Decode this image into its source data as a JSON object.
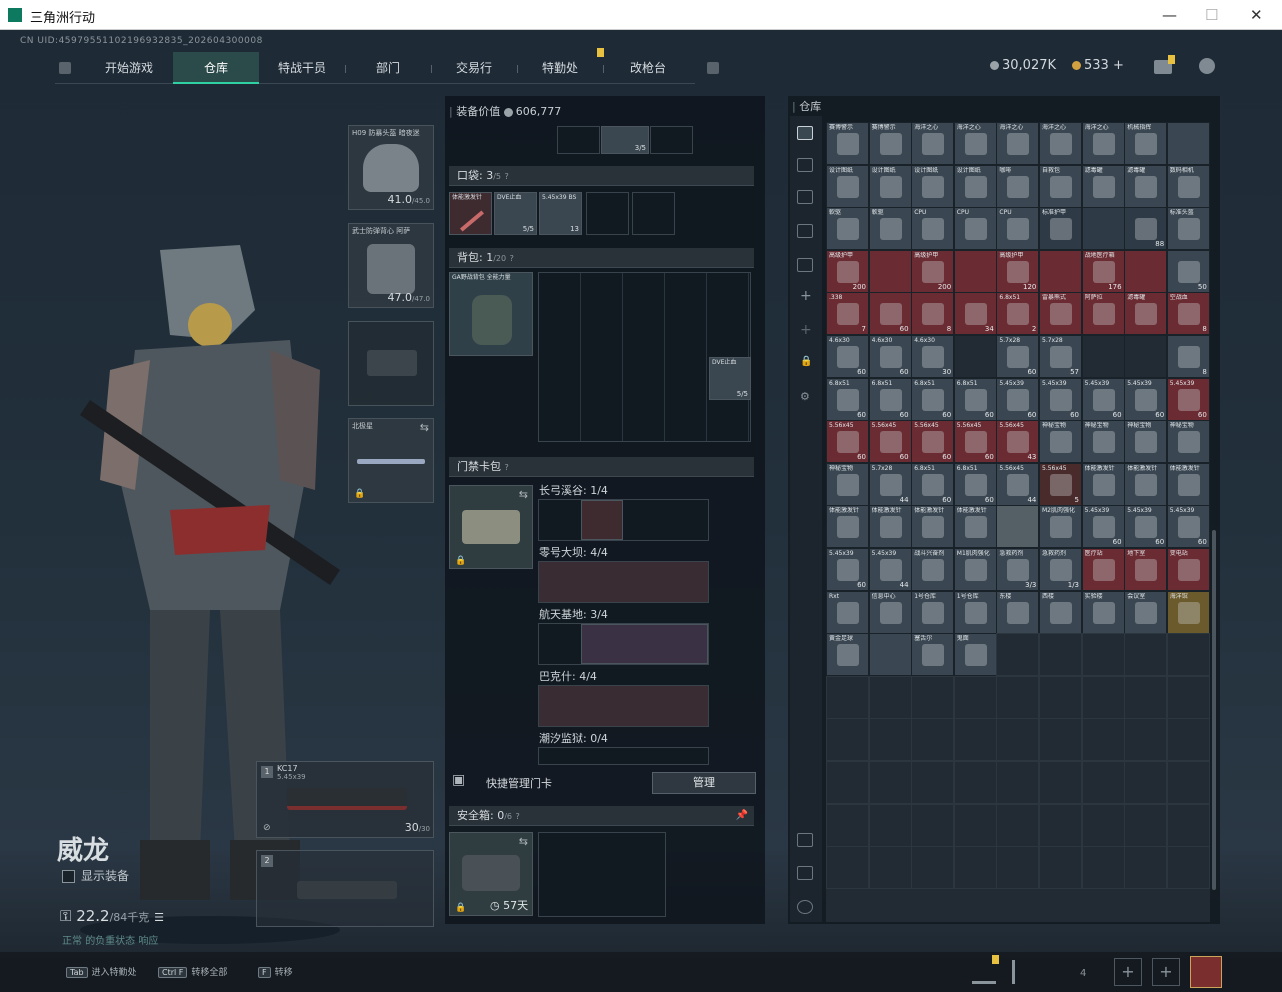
{
  "window": {
    "title": "三角洲行动",
    "minimize": "—",
    "maximize": "☐",
    "close": "✕"
  },
  "uid": "CN UID:4597955110219693283​5_2026043000​08",
  "nav": {
    "tabs": [
      "开始游戏",
      "仓库",
      "特战干员",
      "部门",
      "交易行",
      "特勤处",
      "改枪台"
    ],
    "active": "仓库"
  },
  "currency": {
    "hafcoin": "30,027K",
    "coupons": "533",
    "plus": "+"
  },
  "operator": {
    "name": "威龙",
    "show_equipment": "显示装备",
    "weight": "22.2",
    "weight_max": "/84千克",
    "status_a": "正常",
    "status_b": "的负重状态",
    "status_c": "响应"
  },
  "equip_slots": {
    "helmet": {
      "label": "H09 防暴头盔 暗夜迷",
      "value": "41.0",
      "max": "/45.0"
    },
    "armor": {
      "label": "武士防弹背心 阿萨",
      "value": "47.0",
      "max": "/47.0"
    },
    "melee": {
      "label": "北极星"
    }
  },
  "weapons": [
    {
      "index": "1",
      "name": "KC17",
      "caliber": "5.45x39",
      "ammo": "30",
      "ammo_max": "/30"
    },
    {
      "index": "2"
    }
  ],
  "mid": {
    "equip_value_label": "装备价值",
    "equip_value": "606,777",
    "rig_item_count": "3/5",
    "pocket": {
      "label": "口袋:",
      "count": "3",
      "max": "/5",
      "items": [
        {
          "name": "体能激发针",
          "count": ""
        },
        {
          "name": "DVE止血",
          "count": "5/5"
        },
        {
          "name": "5.45x39 BS",
          "count": "13"
        }
      ]
    },
    "backpack": {
      "label": "背包:",
      "count": "1",
      "max": "/20",
      "name": "GA野战背包 全能力量",
      "item": {
        "name": "DVE止血",
        "count": "5/5"
      }
    },
    "keycase": {
      "label": "门禁卡包",
      "maps": [
        {
          "name": "长弓溪谷: 1/4"
        },
        {
          "name": "零号大坝: 4/4"
        },
        {
          "name": "航天基地: 3/4"
        },
        {
          "name": "巴克什: 4/4"
        },
        {
          "name": "潮汐监狱: 0/4"
        }
      ]
    },
    "quick_keycard": "快捷管理门卡",
    "manage": "管理",
    "safebox": {
      "label": "安全箱:",
      "count": "0",
      "max": "/6",
      "timer": "57天"
    }
  },
  "stash": {
    "title": "仓库"
  },
  "stash_items": [
    {
      "n": "赛博警示",
      "c": "",
      "col": "#3a4651"
    },
    {
      "n": "赛博警示",
      "c": "",
      "col": "#3a4651"
    },
    {
      "n": "海洋之心",
      "c": "",
      "col": "#3a4651"
    },
    {
      "n": "海洋之心",
      "c": "",
      "col": "#3a4651"
    },
    {
      "n": "海洋之心",
      "c": "",
      "col": "#3a4651"
    },
    {
      "n": "海洋之心",
      "c": "",
      "col": "#3a4651"
    },
    {
      "n": "海洋之心",
      "c": "",
      "col": "#3a4651"
    },
    {
      "n": "机械指挥",
      "c": "",
      "col": "#3a4651"
    },
    {
      "n": "",
      "c": "",
      "col": "#3a4651"
    },
    {
      "n": "设计图纸",
      "c": "",
      "col": "#3a4651"
    },
    {
      "n": "设计图纸",
      "c": "",
      "col": "#3a4651"
    },
    {
      "n": "设计图纸",
      "c": "",
      "col": "#3a4651"
    },
    {
      "n": "设计图纸",
      "c": "",
      "col": "#3a4651"
    },
    {
      "n": "咖啡",
      "c": "",
      "col": "#3a4651"
    },
    {
      "n": "自救包",
      "c": "",
      "col": "#3a4651"
    },
    {
      "n": "滤毒罐",
      "c": "",
      "col": "#3a4651"
    },
    {
      "n": "滤毒罐",
      "c": "",
      "col": "#3a4651"
    },
    {
      "n": "数码相机",
      "c": "",
      "col": "#3a4651"
    },
    {
      "n": "軟驱",
      "c": "",
      "col": "#3a4651"
    },
    {
      "n": "軟驱",
      "c": "",
      "col": "#3a4651"
    },
    {
      "n": "CPU",
      "c": "",
      "col": "#3a4651"
    },
    {
      "n": "CPU",
      "c": "",
      "col": "#3a4651"
    },
    {
      "n": "CPU",
      "c": "",
      "col": "#3a4651"
    },
    {
      "n": "标准护甲",
      "c": "",
      "col": "#2e3a46"
    },
    {
      "n": "",
      "c": "",
      "col": "#2e3a46"
    },
    {
      "n": "",
      "c": "88",
      "col": "#2e3a46"
    },
    {
      "n": "标准头盔",
      "c": "",
      "col": "#3a4651"
    },
    {
      "n": "高级护甲",
      "c": "200",
      "col": "#6b2b33"
    },
    {
      "n": "",
      "c": "",
      "col": "#6b2b33"
    },
    {
      "n": "高级护甲",
      "c": "200",
      "col": "#6b2b33"
    },
    {
      "n": "",
      "c": "",
      "col": "#6b2b33"
    },
    {
      "n": "高级护甲",
      "c": "120",
      "col": "#6b2b33"
    },
    {
      "n": "",
      "c": "",
      "col": "#6b2b33"
    },
    {
      "n": "战地医疗箱",
      "c": "176",
      "col": "#6b2b33"
    },
    {
      "n": "",
      "c": "",
      "col": "#6b2b33"
    },
    {
      "n": "",
      "c": "50",
      "col": "#3a4651"
    },
    {
      "n": ".338",
      "c": "7",
      "col": "#6b2b33"
    },
    {
      "n": "",
      "c": "60",
      "col": "#6b2b33"
    },
    {
      "n": "",
      "c": "8",
      "col": "#6b2b33"
    },
    {
      "n": "",
      "c": "34",
      "col": "#6b2b33"
    },
    {
      "n": "6.8x51",
      "c": "2",
      "col": "#6b2b33"
    },
    {
      "n": "雷暴熊式",
      "c": "",
      "col": "#6b2b33"
    },
    {
      "n": "阿萨拉",
      "c": "",
      "col": "#6b2b33"
    },
    {
      "n": "滤毒罐",
      "c": "",
      "col": "#6b2b33"
    },
    {
      "n": "空战血",
      "c": "8",
      "col": "#6b2b33"
    },
    {
      "n": "4.6x30",
      "c": "60",
      "col": "#3a4651"
    },
    {
      "n": "4.6x30",
      "c": "60",
      "col": "#3a4651"
    },
    {
      "n": "4.6x30",
      "c": "30",
      "col": "#3a4651"
    },
    {
      "n": "",
      "c": "",
      "col": "#222b33"
    },
    {
      "n": "5.7x28",
      "c": "60",
      "col": "#3a4651"
    },
    {
      "n": "5.7x28",
      "c": "57",
      "col": "#3a4651"
    },
    {
      "n": "",
      "c": "",
      "col": "#222b33"
    },
    {
      "n": "",
      "c": "",
      "col": "#222b33"
    },
    {
      "n": "",
      "c": "8",
      "col": "#3a4651"
    },
    {
      "n": "6.8x51",
      "c": "60",
      "col": "#3a4651"
    },
    {
      "n": "6.8x51",
      "c": "60",
      "col": "#3a4651"
    },
    {
      "n": "6.8x51",
      "c": "60",
      "col": "#3a4651"
    },
    {
      "n": "6.8x51",
      "c": "60",
      "col": "#3a4651"
    },
    {
      "n": "5.45x39",
      "c": "60",
      "col": "#3a4651"
    },
    {
      "n": "5.45x39",
      "c": "60",
      "col": "#3a4651"
    },
    {
      "n": "5.45x39",
      "c": "60",
      "col": "#3a4651"
    },
    {
      "n": "5.45x39",
      "c": "60",
      "col": "#3a4651"
    },
    {
      "n": "5.45x39",
      "c": "60",
      "col": "#6b2b33"
    },
    {
      "n": "5.56x45",
      "c": "60",
      "col": "#6b2b33"
    },
    {
      "n": "5.56x45",
      "c": "60",
      "col": "#6b2b33"
    },
    {
      "n": "5.56x45",
      "c": "60",
      "col": "#6b2b33"
    },
    {
      "n": "5.56x45",
      "c": "60",
      "col": "#6b2b33"
    },
    {
      "n": "5.56x45",
      "c": "43",
      "col": "#6b2b33"
    },
    {
      "n": "神秘宝物",
      "c": "",
      "col": "#3a4651"
    },
    {
      "n": "神秘宝物",
      "c": "",
      "col": "#3a4651"
    },
    {
      "n": "神秘宝物",
      "c": "",
      "col": "#3a4651"
    },
    {
      "n": "神秘宝物",
      "c": "",
      "col": "#3a4651"
    },
    {
      "n": "神秘宝物",
      "c": "",
      "col": "#3a4651"
    },
    {
      "n": "5.7x28",
      "c": "44",
      "col": "#3a4651"
    },
    {
      "n": "6.8x51",
      "c": "60",
      "col": "#3a4651"
    },
    {
      "n": "6.8x51",
      "c": "60",
      "col": "#3a4651"
    },
    {
      "n": "5.56x45",
      "c": "44",
      "col": "#3a4651"
    },
    {
      "n": "5.56x45",
      "c": "5",
      "col": "#4a2b2b"
    },
    {
      "n": "体能激发针",
      "c": "",
      "col": "#3a4651"
    },
    {
      "n": "体能激发针",
      "c": "",
      "col": "#3a4651"
    },
    {
      "n": "体能激发针",
      "c": "",
      "col": "#3a4651"
    },
    {
      "n": "体能激发针",
      "c": "",
      "col": "#3a4651"
    },
    {
      "n": "体能激发针",
      "c": "",
      "col": "#3a4651"
    },
    {
      "n": "体能激发针",
      "c": "",
      "col": "#3a4651"
    },
    {
      "n": "体能激发针",
      "c": "",
      "col": "#3a4651"
    },
    {
      "n": "",
      "c": "",
      "col": "#555f66"
    },
    {
      "n": "M2肌肉强化",
      "c": "",
      "col": "#3a4651"
    },
    {
      "n": "5.45x39",
      "c": "60",
      "col": "#3a4651"
    },
    {
      "n": "5.45x39",
      "c": "60",
      "col": "#3a4651"
    },
    {
      "n": "5.45x39",
      "c": "60",
      "col": "#3a4651"
    },
    {
      "n": "5.45x39",
      "c": "60",
      "col": "#3a4651"
    },
    {
      "n": "5.45x39",
      "c": "44",
      "col": "#3a4651"
    },
    {
      "n": "战斗兴奋剂",
      "c": "",
      "col": "#3a4651"
    },
    {
      "n": "M1肌肉强化",
      "c": "",
      "col": "#3a4651"
    },
    {
      "n": "急救药剂",
      "c": "3/3",
      "col": "#3a4651"
    },
    {
      "n": "急救药剂",
      "c": "1/3",
      "col": "#3a4651"
    },
    {
      "n": "医疗站",
      "c": "",
      "col": "#6b2b33"
    },
    {
      "n": "地下室",
      "c": "",
      "col": "#6b2b33"
    },
    {
      "n": "变电站",
      "c": "",
      "col": "#6b2b33"
    },
    {
      "n": "Rxt",
      "c": "",
      "col": "#3a4651"
    },
    {
      "n": "信息中心",
      "c": "",
      "col": "#3a4651"
    },
    {
      "n": "1号仓库",
      "c": "",
      "col": "#3a4651"
    },
    {
      "n": "1号仓库",
      "c": "",
      "col": "#3a4651"
    },
    {
      "n": "东楼",
      "c": "",
      "col": "#3a4651"
    },
    {
      "n": "西楼",
      "c": "",
      "col": "#3a4651"
    },
    {
      "n": "实验楼",
      "c": "",
      "col": "#3a4651"
    },
    {
      "n": "会议室",
      "c": "",
      "col": "#3a4651"
    },
    {
      "n": "海洋馆",
      "c": "",
      "col": "#6b5a2b"
    },
    {
      "n": "黄金足球",
      "c": "",
      "col": "#3a4651"
    },
    {
      "n": "",
      "c": "",
      "col": "#3a4651"
    },
    {
      "n": "塞舌尔",
      "c": "",
      "col": "#3a4651"
    },
    {
      "n": "鬼面",
      "c": "",
      "col": "#3a4651"
    }
  ],
  "bottom": {
    "hint1_key": "Tab",
    "hint1": "进入特勤处",
    "hint2_key": "Ctrl F",
    "hint2": "转移全部",
    "hint3_key": "F",
    "hint3": "转移",
    "team_count": "4"
  },
  "colors": {
    "accent": "#2fd1a3",
    "red_tier": "#6b2b33",
    "gold": "#e9c140"
  }
}
